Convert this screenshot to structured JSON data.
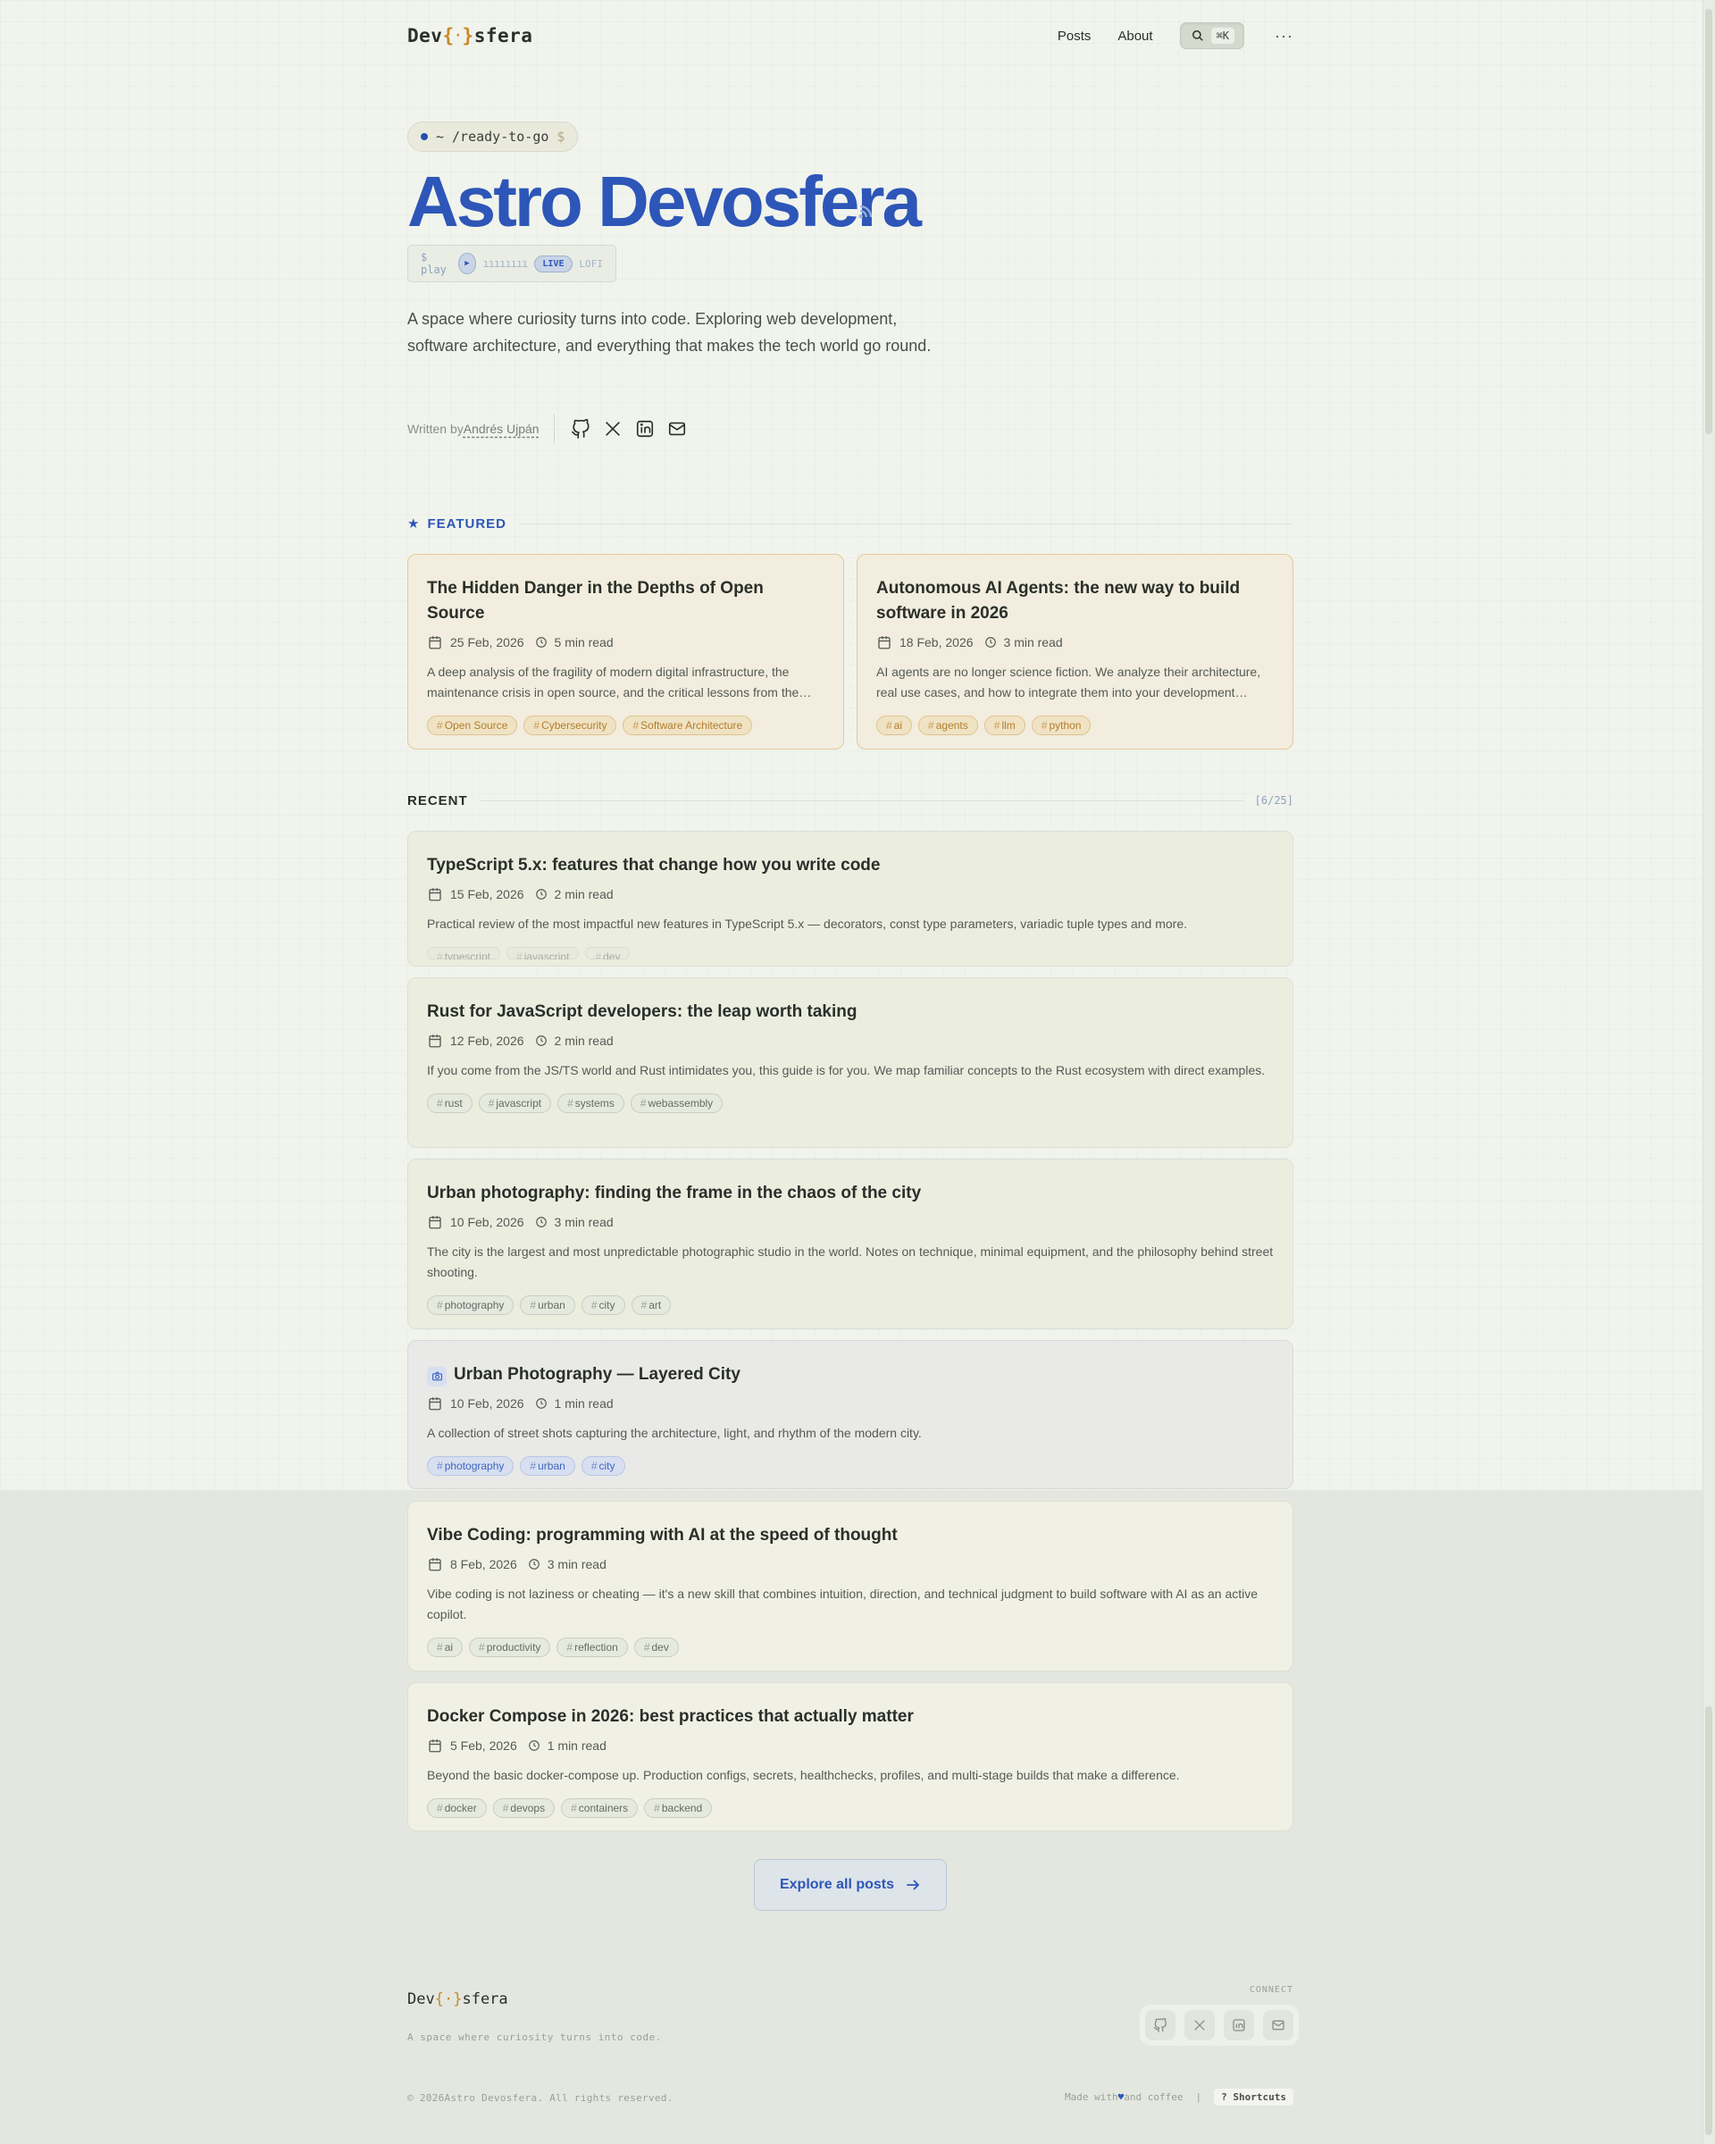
{
  "header": {
    "logo_prefix": "Dev",
    "logo_open": "{",
    "logo_dot": "·",
    "logo_close": "}",
    "logo_suffix": "sfera",
    "nav": [
      {
        "label": "Posts"
      },
      {
        "label": "About"
      }
    ],
    "search_shortcut": "⌘K",
    "more": "···"
  },
  "hero": {
    "pill_tilde": "~",
    "pill_path": "/ready-to-go",
    "pill_dollar": "$",
    "title": "Astro Devosfera",
    "player": {
      "cmd": "$ play",
      "bars": "ıııııııı",
      "live": "LIVE",
      "mode": "LOFI"
    },
    "description": "A space where curiosity turns into code. Exploring web development, software architecture, and everything that makes the tech world go round.",
    "written_by": "Written by",
    "author": "Andrés Ujpán"
  },
  "featured": {
    "label": "FEATURED",
    "posts": [
      {
        "title": "The Hidden Danger in the Depths of Open Source",
        "date": "25 Feb, 2026",
        "read": "5 min read",
        "excerpt": "A deep analysis of the fragility of modern digital infrastructure, the maintenance crisis in open source, and the critical lessons from the…",
        "tags": [
          "Open Source",
          "Cybersecurity",
          "Software Architecture"
        ]
      },
      {
        "title": "Autonomous AI Agents: the new way to build software in 2026",
        "date": "18 Feb, 2026",
        "read": "3 min read",
        "excerpt": "AI agents are no longer science fiction. We analyze their architecture, real use cases, and how to integrate them into your development…",
        "tags": [
          "ai",
          "agents",
          "llm",
          "python"
        ]
      }
    ]
  },
  "recent": {
    "label": "RECENT",
    "count": "[6/25]",
    "posts": [
      {
        "title": "TypeScript 5.x: features that change how you write code",
        "date": "15 Feb, 2026",
        "read": "2 min read",
        "excerpt": "Practical review of the most impactful new features in TypeScript 5.x — decorators, const type parameters, variadic tuple types and more.",
        "tags": [
          "typescript",
          "javascript",
          "dev"
        ]
      },
      {
        "title": "Rust for JavaScript developers: the leap worth taking",
        "date": "12 Feb, 2026",
        "read": "2 min read",
        "excerpt": "If you come from the JS/TS world and Rust intimidates you, this guide is for you. We map familiar concepts to the Rust ecosystem with direct examples.",
        "tags": [
          "rust",
          "javascript",
          "systems",
          "webassembly"
        ]
      },
      {
        "title": "Urban photography: finding the frame in the chaos of the city",
        "date": "10 Feb, 2026",
        "read": "3 min read",
        "excerpt": "The city is the largest and most unpredictable photographic studio in the world. Notes on technique, minimal equipment, and the philosophy behind street shooting.",
        "tags": [
          "photography",
          "urban",
          "city",
          "art"
        ]
      },
      {
        "title": "Urban Photography — Layered City",
        "date": "10 Feb, 2026",
        "read": "1 min read",
        "excerpt": "A collection of street shots capturing the architecture, light, and rhythm of the modern city.",
        "tags": [
          "photography",
          "urban",
          "city"
        ]
      },
      {
        "title": "Vibe Coding: programming with AI at the speed of thought",
        "date": "8 Feb, 2026",
        "read": "3 min read",
        "excerpt": "Vibe coding is not laziness or cheating — it's a new skill that combines intuition, direction, and technical judgment to build software with AI as an active copilot.",
        "tags": [
          "ai",
          "productivity",
          "reflection",
          "dev"
        ]
      },
      {
        "title": "Docker Compose in 2026: best practices that actually matter",
        "date": "5 Feb, 2026",
        "read": "1 min read",
        "excerpt": "Beyond the basic docker-compose up. Production configs, secrets, healthchecks, profiles, and multi-stage builds that make a difference.",
        "tags": [
          "docker",
          "devops",
          "containers",
          "backend"
        ]
      }
    ]
  },
  "explore_label": "Explore all posts",
  "footer": {
    "tagline": "A space where curiosity turns into code.",
    "connect": "CONNECT",
    "copyright": "© 2026Astro Devosfera. All rights reserved.",
    "made_prefix": "Made with",
    "made_heart": "♥",
    "made_suffix": "and coffee",
    "divider": "|",
    "shortcuts": "? Shortcuts"
  },
  "colors": {
    "accent": "#2d56b8",
    "brand_bracket": "#c68a2a",
    "featured_border": "#e5c99a"
  },
  "icons": [
    "search-icon",
    "rss-icon",
    "play-icon",
    "github-icon",
    "x-icon",
    "linkedin-icon",
    "mail-icon",
    "star-icon",
    "calendar-icon",
    "clock-icon",
    "camera-icon",
    "arrow-right-icon"
  ]
}
